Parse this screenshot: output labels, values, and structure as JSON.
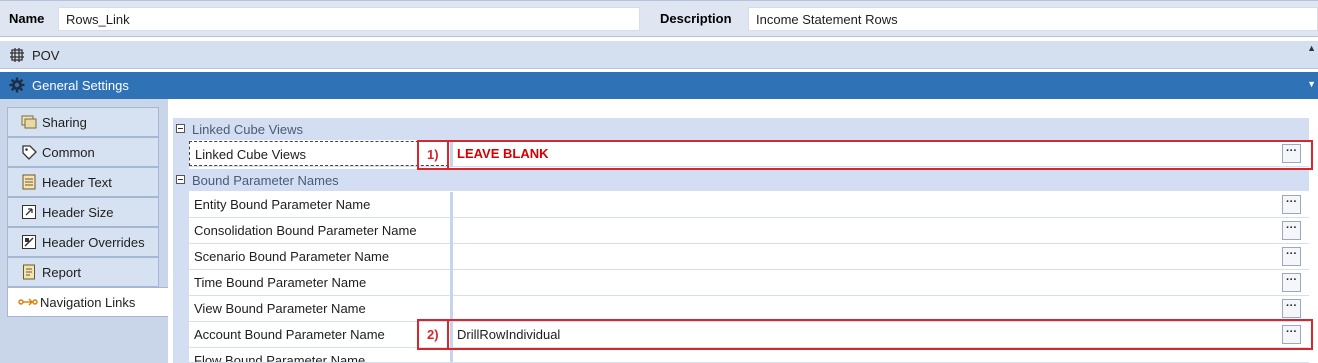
{
  "header": {
    "name_label": "Name",
    "name_value": "Rows_Link",
    "description_label": "Description",
    "description_value": "Income Statement Rows"
  },
  "pov_bar": {
    "label": "POV",
    "icon": "pov-grid-icon"
  },
  "general_settings_bar": {
    "label": "General Settings",
    "icon": "gear-icon"
  },
  "side_tabs": [
    {
      "label": "Sharing",
      "icon": "sharing-icon"
    },
    {
      "label": "Common",
      "icon": "tag-icon"
    },
    {
      "label": "Header Text",
      "icon": "header-text-icon"
    },
    {
      "label": "Header Size",
      "icon": "header-size-icon"
    },
    {
      "label": "Header Overrides",
      "icon": "header-overrides-icon"
    },
    {
      "label": "Report",
      "icon": "report-icon"
    },
    {
      "label": "Navigation Links",
      "icon": "navigation-links-icon",
      "active": true
    }
  ],
  "property_grid": {
    "categories": [
      {
        "label": "Linked Cube Views"
      },
      {
        "label": "Bound Parameter Names"
      }
    ],
    "rows": [
      {
        "name": "Linked Cube Views",
        "value": "LEAVE BLANK"
      },
      {
        "name": "Entity Bound Parameter Name",
        "value": ""
      },
      {
        "name": "Consolidation Bound Parameter Name",
        "value": ""
      },
      {
        "name": "Scenario Bound Parameter Name",
        "value": ""
      },
      {
        "name": "Time Bound Parameter Name",
        "value": ""
      },
      {
        "name": "View Bound Parameter Name",
        "value": ""
      },
      {
        "name": "Account Bound Parameter Name",
        "value": "DrillRowIndividual"
      },
      {
        "name": "Flow Bound Parameter Name",
        "value": ""
      }
    ],
    "ellipsis_label": "···"
  },
  "annotations": [
    {
      "number": "1)"
    },
    {
      "number": "2)"
    }
  ],
  "colors": {
    "accent_bar": "#2f73b6",
    "annotation_red": "#d7262c",
    "value_red": "#d40000",
    "category_bg": "#d3def2"
  }
}
